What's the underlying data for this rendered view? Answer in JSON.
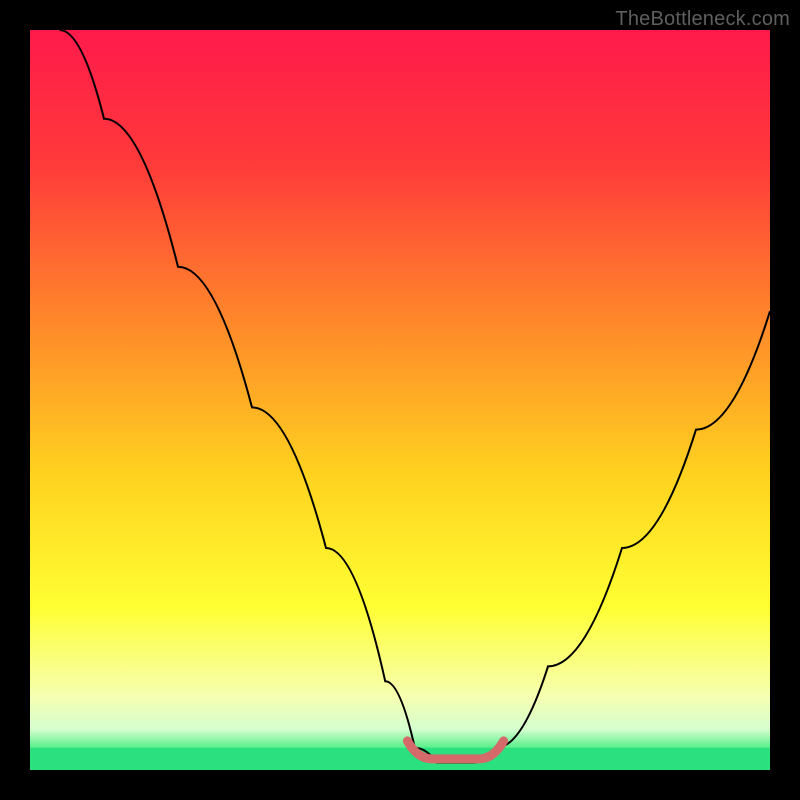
{
  "watermark": "TheBottleneck.com",
  "colors": {
    "gradient_stops": [
      {
        "offset": 0.0,
        "color": "#ff1a4b"
      },
      {
        "offset": 0.18,
        "color": "#ff3a3a"
      },
      {
        "offset": 0.4,
        "color": "#ff8a2a"
      },
      {
        "offset": 0.6,
        "color": "#ffd21f"
      },
      {
        "offset": 0.78,
        "color": "#ffff33"
      },
      {
        "offset": 0.9,
        "color": "#f6ffb0"
      },
      {
        "offset": 0.945,
        "color": "#d6ffcf"
      },
      {
        "offset": 0.97,
        "color": "#57ef89"
      },
      {
        "offset": 1.0,
        "color": "#23e07a"
      }
    ],
    "green_band": "#2be07e",
    "curve": "#000000",
    "flat_highlight": "#d46a6a"
  },
  "chart_data": {
    "type": "line",
    "title": "",
    "xlabel": "",
    "ylabel": "",
    "xlim": [
      0,
      100
    ],
    "ylim": [
      0,
      100
    ],
    "green_band_y_range": [
      0,
      3
    ],
    "series": [
      {
        "name": "bottleneck-curve",
        "x": [
          4,
          10,
          20,
          30,
          40,
          48,
          52,
          55,
          60,
          63,
          70,
          80,
          90,
          100
        ],
        "y": [
          100,
          88,
          68,
          49,
          30,
          12,
          3,
          1,
          1,
          3,
          14,
          30,
          46,
          62
        ]
      }
    ],
    "flat_segment": {
      "x_start": 51,
      "x_end": 64,
      "y": 1.5
    },
    "annotations": []
  }
}
